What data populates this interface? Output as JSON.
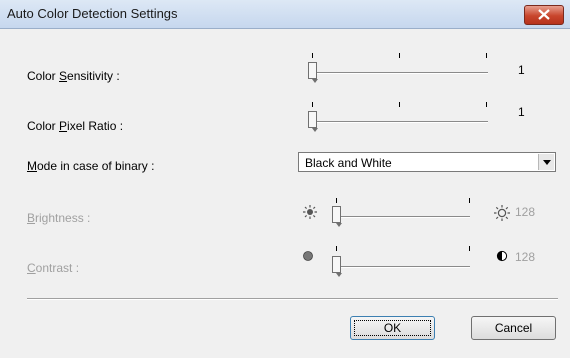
{
  "window": {
    "title": "Auto Color Detection Settings",
    "close_icon": "close-icon"
  },
  "color_sensitivity": {
    "label_pre": "Color ",
    "label_u": "S",
    "label_post": "ensitivity :",
    "value": "1",
    "min": 1,
    "max": 5
  },
  "color_pixel_ratio": {
    "label_pre": "Color ",
    "label_u": "P",
    "label_post": "ixel Ratio :",
    "value": "1",
    "min": 1,
    "max": 5
  },
  "binary_mode": {
    "label_u": "M",
    "label_post": "ode in case of binary :",
    "selected": "Black and White"
  },
  "brightness": {
    "label_u": "B",
    "label_post": "rightness :",
    "value": "128",
    "enabled": false,
    "low_icon": "sun-small-icon",
    "high_icon": "sun-large-icon"
  },
  "contrast": {
    "label_u": "C",
    "label_post": "ontrast :",
    "value": "128",
    "enabled": false,
    "low_icon": "circle-filled-icon",
    "high_icon": "half-circle-icon"
  },
  "buttons": {
    "ok": "OK",
    "cancel": "Cancel"
  }
}
